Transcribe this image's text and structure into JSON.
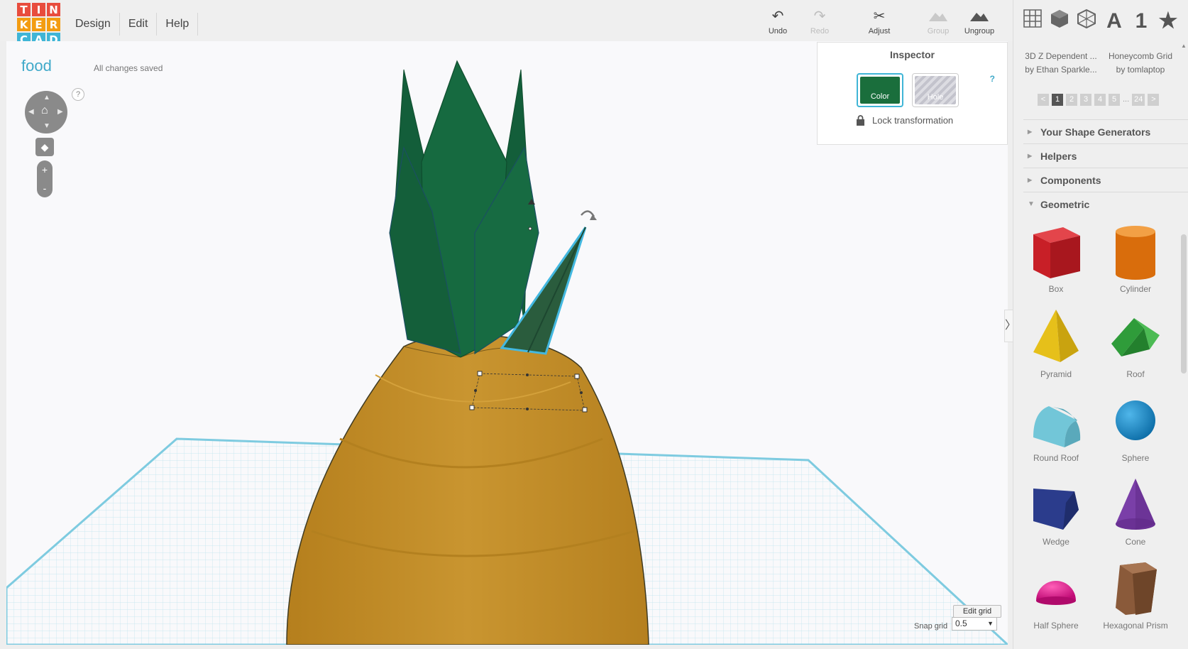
{
  "app": {
    "logo_letters": [
      "T",
      "I",
      "N",
      "K",
      "E",
      "R",
      "C",
      "A",
      "D"
    ],
    "logo_colors": [
      "#e84c3d",
      "#e84c3d",
      "#e84c3d",
      "#f39c12",
      "#f39c12",
      "#f39c12",
      "#3fb5d6",
      "#3fb5d6",
      "#3fb5d6"
    ]
  },
  "menu": {
    "items": [
      "Design",
      "Edit",
      "Help"
    ]
  },
  "toolbar": {
    "undo": "Undo",
    "redo": "Redo",
    "adjust": "Adjust",
    "group": "Group",
    "ungroup": "Ungroup"
  },
  "view_icons": {
    "text_glyph": "A",
    "number_glyph": "1"
  },
  "document": {
    "title": "food",
    "status": "All changes saved"
  },
  "view_controls": {
    "help": "?",
    "zoom_in": "+",
    "zoom_out": "-"
  },
  "inspector": {
    "title": "Inspector",
    "color_label": "Color",
    "hole_label": "Hole",
    "help": "?",
    "lock_label": "Lock transformation",
    "selected_color": "#1a6e3c"
  },
  "grid": {
    "edit_label": "Edit grid",
    "snap_label": "Snap grid",
    "snap_value": "0.5"
  },
  "panel": {
    "generators": [
      {
        "title": "3D Z Dependent ...",
        "author": "by Ethan Sparkle..."
      },
      {
        "title": "Honeycomb Grid",
        "author": "by tomlaptop"
      }
    ],
    "pager": [
      "<",
      "1",
      "2",
      "3",
      "4",
      "5",
      "...",
      "24",
      ">"
    ],
    "active_page": "1",
    "sections": [
      {
        "label": "Your Shape Generators",
        "expanded": false
      },
      {
        "label": "Helpers",
        "expanded": false
      },
      {
        "label": "Components",
        "expanded": false
      },
      {
        "label": "Geometric",
        "expanded": true
      }
    ],
    "shapes": [
      {
        "label": "Box",
        "color": "#d9222a"
      },
      {
        "label": "Cylinder",
        "color": "#e5780f"
      },
      {
        "label": "Pyramid",
        "color": "#eac517"
      },
      {
        "label": "Roof",
        "color": "#2f9c3a"
      },
      {
        "label": "Round Roof",
        "color": "#6cc4d6"
      },
      {
        "label": "Sphere",
        "color": "#1a8fd0"
      },
      {
        "label": "Wedge",
        "color": "#2b3c8c"
      },
      {
        "label": "Cone",
        "color": "#7a3fa8"
      },
      {
        "label": "Half Sphere",
        "color": "#e0138c"
      },
      {
        "label": "Hexagonal Prism",
        "color": "#8a5a3a"
      }
    ]
  }
}
